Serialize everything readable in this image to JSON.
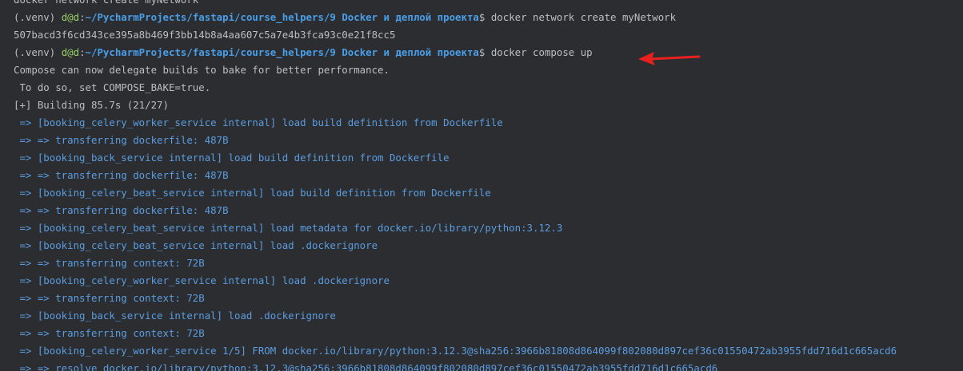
{
  "terminal": {
    "top_partial": "docker network create myNetwork",
    "prompt": {
      "venv": "(.venv) ",
      "user": "d@d",
      "colon": ":",
      "path": "~/PycharmProjects/fastapi/course_helpers/9 Docker и деплой проекта",
      "dollar": "$ "
    },
    "commands": [
      "docker network create myNetwork",
      "docker compose up"
    ],
    "network_id": "507bacd3f6cd343ce395a8b469f3bb14b8a4aa607c5a7e4b3fca93c0e21f8cc5",
    "compose_note_1": "Compose can now delegate builds to bake for better performance.",
    "compose_note_2": " To do so, set COMPOSE_BAKE=true.",
    "building_status": "[+] Building 85.7s (21/27)",
    "build_lines": [
      " => [booking_celery_worker_service internal] load build definition from Dockerfile",
      " => => transferring dockerfile: 487B",
      " => [booking_back_service internal] load build definition from Dockerfile",
      " => => transferring dockerfile: 487B",
      " => [booking_celery_beat_service internal] load build definition from Dockerfile",
      " => => transferring dockerfile: 487B",
      " => [booking_celery_beat_service internal] load metadata for docker.io/library/python:3.12.3",
      " => [booking_celery_beat_service internal] load .dockerignore",
      " => => transferring context: 72B",
      " => [booking_celery_worker_service internal] load .dockerignore",
      " => => transferring context: 72B",
      " => [booking_back_service internal] load .dockerignore",
      " => => transferring context: 72B",
      " => [booking_celery_worker_service 1/5] FROM docker.io/library/python:3.12.3@sha256:3966b81808d864099f802080d897cef36c01550472ab3955fdd716d1c665acd6",
      " => => resolve docker.io/library/python:3.12.3@sha256:3966b81808d864099f802080d897cef36c01550472ab3955fdd716d1c665acd6"
    ],
    "colors": {
      "background": "#2b2d30",
      "text": "#bcbec4",
      "user": "#9acd68",
      "path": "#4a9ee8",
      "build": "#5b9de0",
      "arrow": "#e8201e"
    },
    "annotation_icon": "red-arrow-icon"
  }
}
